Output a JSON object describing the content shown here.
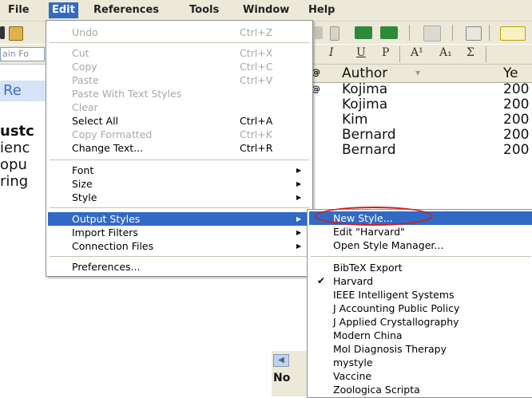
{
  "menubar": {
    "items": [
      "File",
      "Edit",
      "References",
      "Tools",
      "Window",
      "Help"
    ],
    "active": "Edit"
  },
  "toolbar": {
    "field_text": "ain Fo",
    "format_glyphs": [
      "I",
      "U",
      "P",
      "A¹",
      "A₁",
      "Σ"
    ],
    "accent": "#316ac5"
  },
  "left_panel": {
    "header": "Re",
    "lines": [
      "ustc",
      "ienc",
      "opu",
      "ring"
    ]
  },
  "list": {
    "author_header": "Author",
    "year_header": "Ye",
    "rows": [
      {
        "author": "Kojima",
        "year": "200"
      },
      {
        "author": "Kojima",
        "year": "200"
      },
      {
        "author": "Kim",
        "year": "200"
      },
      {
        "author": "Bernard",
        "year": "200"
      },
      {
        "author": "Bernard",
        "year": "200"
      }
    ],
    "bottom_label": "No"
  },
  "edit_menu": {
    "items": [
      {
        "label": "Undo",
        "shortcut": "Ctrl+Z",
        "enabled": false
      },
      {
        "label": "Cut",
        "shortcut": "Ctrl+X",
        "enabled": false
      },
      {
        "label": "Copy",
        "shortcut": "Ctrl+C",
        "enabled": false
      },
      {
        "label": "Paste",
        "shortcut": "Ctrl+V",
        "enabled": false
      },
      {
        "label": "Paste With Text Styles",
        "shortcut": "",
        "enabled": false
      },
      {
        "label": "Clear",
        "shortcut": "",
        "enabled": false
      },
      {
        "label": "Select All",
        "shortcut": "Ctrl+A",
        "enabled": true
      },
      {
        "label": "Copy Formatted",
        "shortcut": "Ctrl+K",
        "enabled": false
      },
      {
        "label": "Change Text...",
        "shortcut": "Ctrl+R",
        "enabled": true
      },
      {
        "label": "Font",
        "submenu": true,
        "enabled": true
      },
      {
        "label": "Size",
        "submenu": true,
        "enabled": true
      },
      {
        "label": "Style",
        "submenu": true,
        "enabled": true
      },
      {
        "label": "Output Styles",
        "submenu": true,
        "enabled": true,
        "highlighted": true
      },
      {
        "label": "Import Filters",
        "submenu": true,
        "enabled": true
      },
      {
        "label": "Connection Files",
        "submenu": true,
        "enabled": true
      },
      {
        "label": "Preferences...",
        "shortcut": "",
        "enabled": true
      }
    ]
  },
  "output_styles_menu": {
    "actions": [
      "New Style...",
      "Edit \"Harvard\"",
      "Open Style Manager..."
    ],
    "styles": [
      "BibTeX Export",
      "Harvard",
      "IEEE Intelligent Systems",
      "J Accounting Public Policy",
      "J Applied Crystallography",
      "Modern China",
      "Mol Diagnosis Therapy",
      "mystyle",
      "Vaccine",
      "Zoologica Scripta"
    ],
    "checked": "Harvard",
    "highlighted": "New Style...",
    "annotation_color": "#d21d1d"
  }
}
